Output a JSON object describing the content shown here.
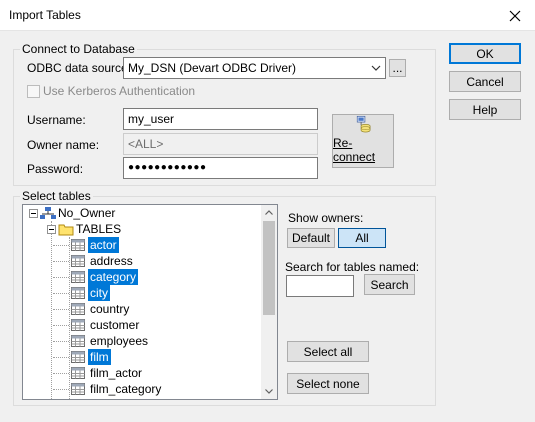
{
  "window": {
    "title": "Import Tables"
  },
  "buttons": {
    "ok": "OK",
    "cancel": "Cancel",
    "help": "Help"
  },
  "connect": {
    "group_label": "Connect to Database",
    "dsn_label": "ODBC data source:",
    "dsn_value": "My_DSN (Devart ODBC Driver)",
    "browse": "...",
    "kerberos": "Use Kerberos Authentication",
    "kerberos_checked": false,
    "username_label": "Username:",
    "username_value": "my_user",
    "owner_label": "Owner name:",
    "owner_value": "<ALL>",
    "password_label": "Password:",
    "password_value": "●●●●●●●●●●●●",
    "reconnect": "Re-connect"
  },
  "select": {
    "group_label": "Select tables",
    "tree": {
      "root": "No_Owner",
      "folder": "TABLES",
      "tables": [
        {
          "name": "actor",
          "selected": true
        },
        {
          "name": "address",
          "selected": false
        },
        {
          "name": "category",
          "selected": true
        },
        {
          "name": "city",
          "selected": true
        },
        {
          "name": "country",
          "selected": false
        },
        {
          "name": "customer",
          "selected": false
        },
        {
          "name": "employees",
          "selected": false
        },
        {
          "name": "film",
          "selected": true
        },
        {
          "name": "film_actor",
          "selected": false
        },
        {
          "name": "film_category",
          "selected": false
        }
      ]
    },
    "show_owners_label": "Show owners:",
    "owners_default": "Default",
    "owners_all": "All",
    "owners_selected": "All",
    "search_label": "Search for tables named:",
    "search_value": "",
    "search_button": "Search",
    "select_all": "Select all",
    "select_none": "Select none"
  }
}
